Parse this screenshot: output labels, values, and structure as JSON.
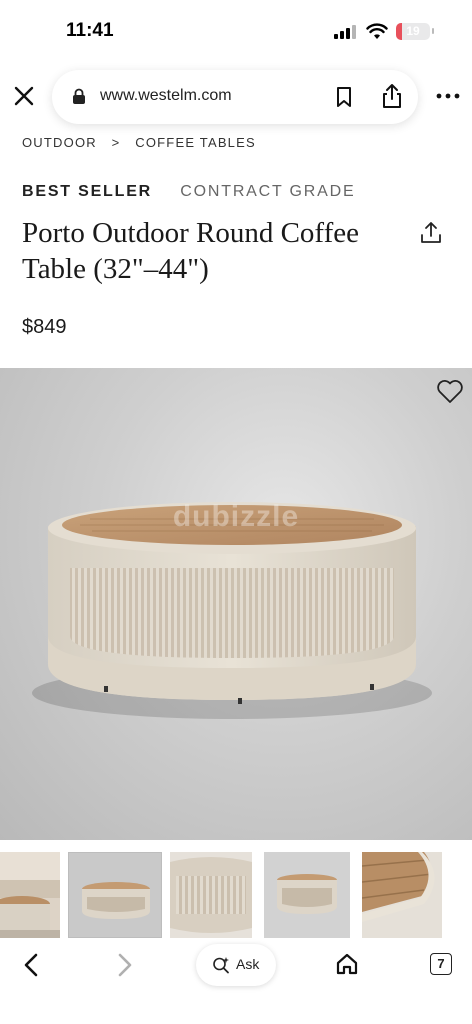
{
  "status_bar": {
    "time": "11:41",
    "battery": "19",
    "battery_level": 0.19,
    "battery_color": "#e8505b"
  },
  "browser": {
    "url": "www.westelm.com",
    "icons": [
      "close-icon",
      "lock-icon",
      "bookmark-icon",
      "share-icon",
      "more-icon"
    ]
  },
  "breadcrumb": {
    "items": [
      "OUTDOOR",
      ">",
      "COFFEE TABLES"
    ]
  },
  "product": {
    "badges": [
      "BEST SELLER",
      "CONTRACT GRADE"
    ],
    "title": "Porto Outdoor Round Coffee Table (32\"–44\")",
    "price": "$849"
  },
  "hero": {
    "watermark": "dubizzle",
    "wishlist_icon": "heart-icon"
  },
  "thumbnails": {
    "count": 5,
    "selected_index": 1
  },
  "toolbar": {
    "ask_label": "Ask",
    "tabs_count": "7",
    "icons": [
      "back-icon",
      "forward-icon",
      "sparkle-search-icon",
      "home-icon",
      "tabs-icon"
    ]
  }
}
